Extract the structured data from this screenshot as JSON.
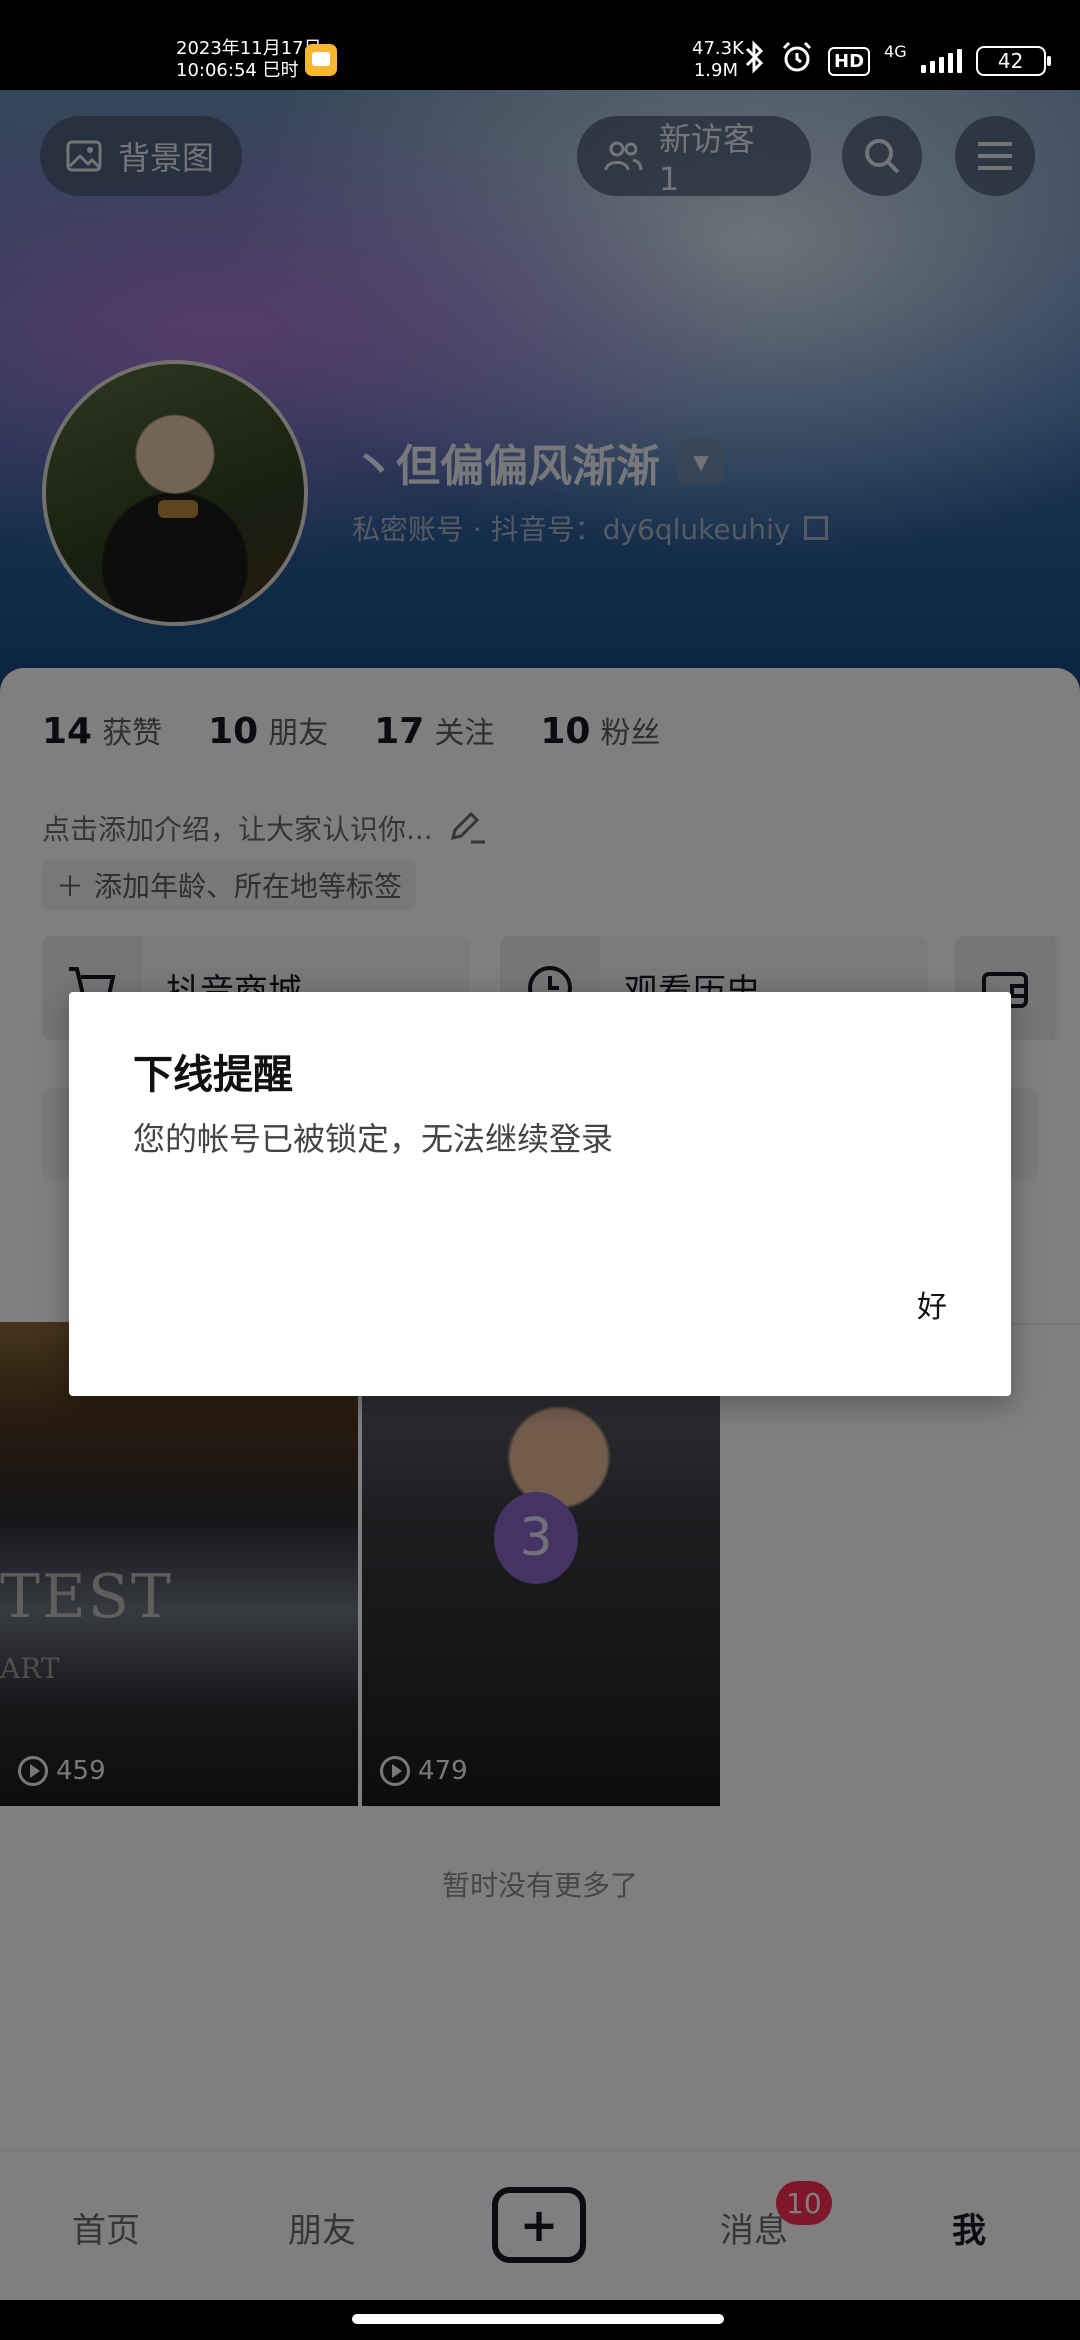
{
  "status_bar": {
    "date": "2023年11月17日",
    "time": "10:06:54 巳时",
    "speed_up": "47.3K",
    "speed_down": "1.9M",
    "hd": "HD",
    "network": "4G",
    "battery": "42"
  },
  "header": {
    "background_button": "背景图",
    "visitor_button": "新访客 1"
  },
  "profile": {
    "name": "丶但偏偏风渐渐",
    "account_type": "私密账号 · 抖音号：dy6qlukeuhiy"
  },
  "stats": [
    {
      "value": "14",
      "label": "获赞"
    },
    {
      "value": "10",
      "label": "朋友"
    },
    {
      "value": "17",
      "label": "关注"
    },
    {
      "value": "10",
      "label": "粉丝"
    }
  ],
  "bio": {
    "intro": "点击添加介绍，让大家认识你...",
    "tag": "添加年龄、所在地等标签"
  },
  "shortcuts": [
    {
      "label": "抖音商城",
      "icon": "cart-icon"
    },
    {
      "label": "观看历史",
      "icon": "clock-icon"
    },
    {
      "label": "",
      "icon": "wallet-icon"
    }
  ],
  "videos": [
    {
      "plays": "459",
      "overlay_text": "TEST",
      "overlay_text_2": "ART"
    },
    {
      "plays": "479",
      "overlay_text": "3"
    }
  ],
  "no_more_text": "暂时没有更多了",
  "bottom_nav": {
    "home": "首页",
    "friends": "朋友",
    "plus": "+",
    "messages": "消息",
    "messages_badge": "10",
    "me": "我"
  },
  "dialog": {
    "title": "下线提醒",
    "message": "您的帐号已被锁定，无法继续登录",
    "ok_button": "好"
  }
}
